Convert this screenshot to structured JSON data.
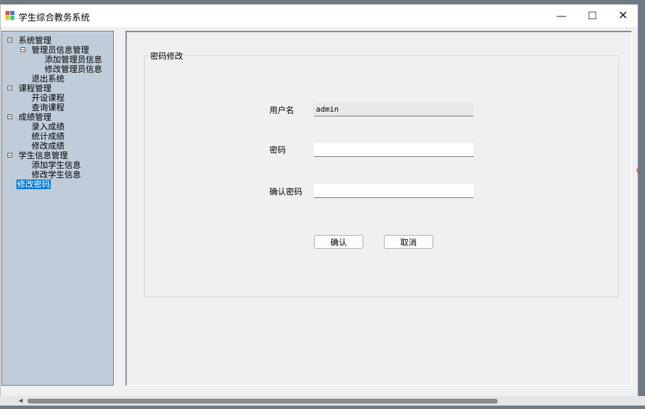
{
  "window": {
    "title": "学生综合教务系统",
    "controls": {
      "minimize": "—",
      "maximize": "☐",
      "close": "✕"
    }
  },
  "tree": {
    "items": [
      {
        "label": "系统管理",
        "expanded": true
      },
      {
        "label": "管理员信息管理",
        "expanded": true
      },
      {
        "label": "添加管理员信息"
      },
      {
        "label": "修改管理员信息"
      },
      {
        "label": "退出系统"
      },
      {
        "label": "课程管理",
        "expanded": true
      },
      {
        "label": "开设课程"
      },
      {
        "label": "查询课程"
      },
      {
        "label": "成绩管理",
        "expanded": true
      },
      {
        "label": "录入成绩"
      },
      {
        "label": "统计成绩"
      },
      {
        "label": "修改成绩"
      },
      {
        "label": "学生信息管理",
        "expanded": true
      },
      {
        "label": "添加学生信息"
      },
      {
        "label": "修改学生信息"
      },
      {
        "label": "修改密码",
        "selected": true
      }
    ]
  },
  "form": {
    "group_title": "密码修改",
    "username_label": "用户名",
    "username_value": "admin",
    "password_label": "密码",
    "password_value": "",
    "confirm_label": "确认密码",
    "confirm_value": "",
    "confirm_button": "确认",
    "cancel_button": "取消"
  },
  "colors": {
    "tree_background": "#bfcdda",
    "selection": "#0078d7",
    "window_background": "#f0f0f0"
  }
}
